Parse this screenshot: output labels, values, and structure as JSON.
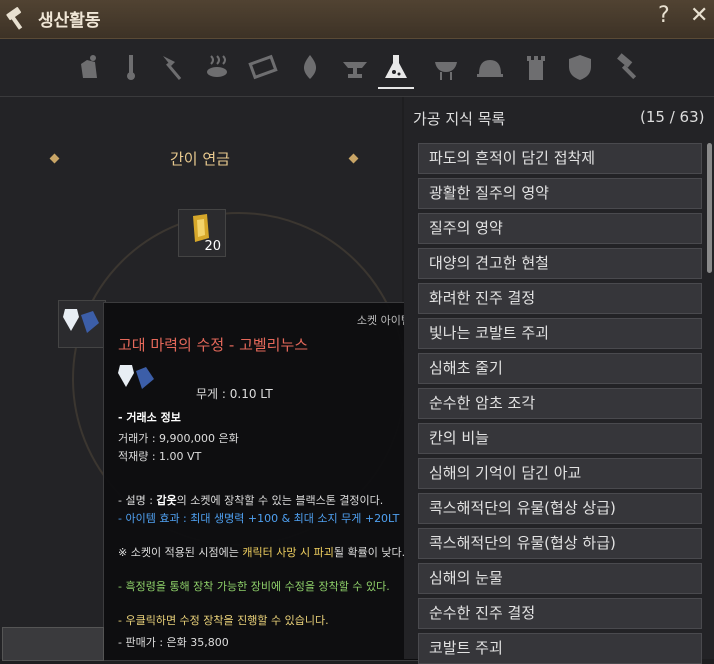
{
  "window": {
    "title": "생산활동",
    "help_label": "?",
    "close_label": "✕"
  },
  "tabs": [
    {
      "icon": "gathering-icon"
    },
    {
      "icon": "fishing-rod-icon"
    },
    {
      "icon": "axe-icon"
    },
    {
      "icon": "fish-icon"
    },
    {
      "icon": "grill-icon"
    },
    {
      "icon": "flame-icon"
    },
    {
      "icon": "anvil-icon"
    },
    {
      "icon": "flask-icon",
      "active": true
    },
    {
      "icon": "bbq-icon"
    },
    {
      "icon": "cloche-icon"
    },
    {
      "icon": "tower-icon"
    },
    {
      "icon": "shield-icon"
    },
    {
      "icon": "hammer-icon"
    }
  ],
  "recipe": {
    "title": "간이 연금",
    "top_slot_count": "20"
  },
  "tooltip": {
    "category": "소켓 아이템",
    "name": "고대 마력의 수정 - 고벨리누스",
    "weight": "무게 :  0.10 LT",
    "market_header": "- 거래소 정보",
    "price": "거래가 : 9,900,000 은화",
    "stock": "적재량 : 1.00 VT",
    "desc_prefix": "- 설명 : ",
    "desc_highlight": "갑옷",
    "desc_rest": "의 소켓에 장착할 수 있는 블랙스톤 결정이다.",
    "effect": "- 아이템 효과 : 최대 생명력 +100 & 최대 소지 무게 +20LT",
    "warn_prefix": "※ 소켓이 적용된 시점에는 ",
    "warn_highlight": "캐릭터 사망 시 파괴",
    "warn_rest": "될 확률이 낮다.",
    "note_green": "- 흑정령을 통해 장착 가능한 장비에 수정을 장착할 수 있다.",
    "note_yellow": "- 우클릭하면 수정 장착을 진행할 수 있습니다.",
    "sell": "- 판매가 :  은화 35,800"
  },
  "list": {
    "header": "가공 지식 목록",
    "count": "(15 / 63)",
    "items": [
      "파도의 흔적이 담긴 접착제",
      "광활한 질주의 영약",
      "질주의 영약",
      "대양의 견고한 현철",
      "화려한 진주 결정",
      "빛나는 코발트 주괴",
      "심해초 줄기",
      "순수한 암초 조각",
      "칸의 비늘",
      "심해의 기억이 담긴 아교",
      "콕스해적단의 유물(협상 상급)",
      "콕스해적단의 유물(협상 하급)",
      "심해의 눈물",
      "순수한 진주 결정",
      "코발트 주괴"
    ]
  },
  "colors": {
    "accent_gold": "#c9a566",
    "tooltip_name": "#e4685a",
    "effect_blue": "#4fa0f0",
    "warn_yellow": "#f0d060",
    "note_green": "#8fd16a",
    "note_yellow": "#ead27a"
  }
}
